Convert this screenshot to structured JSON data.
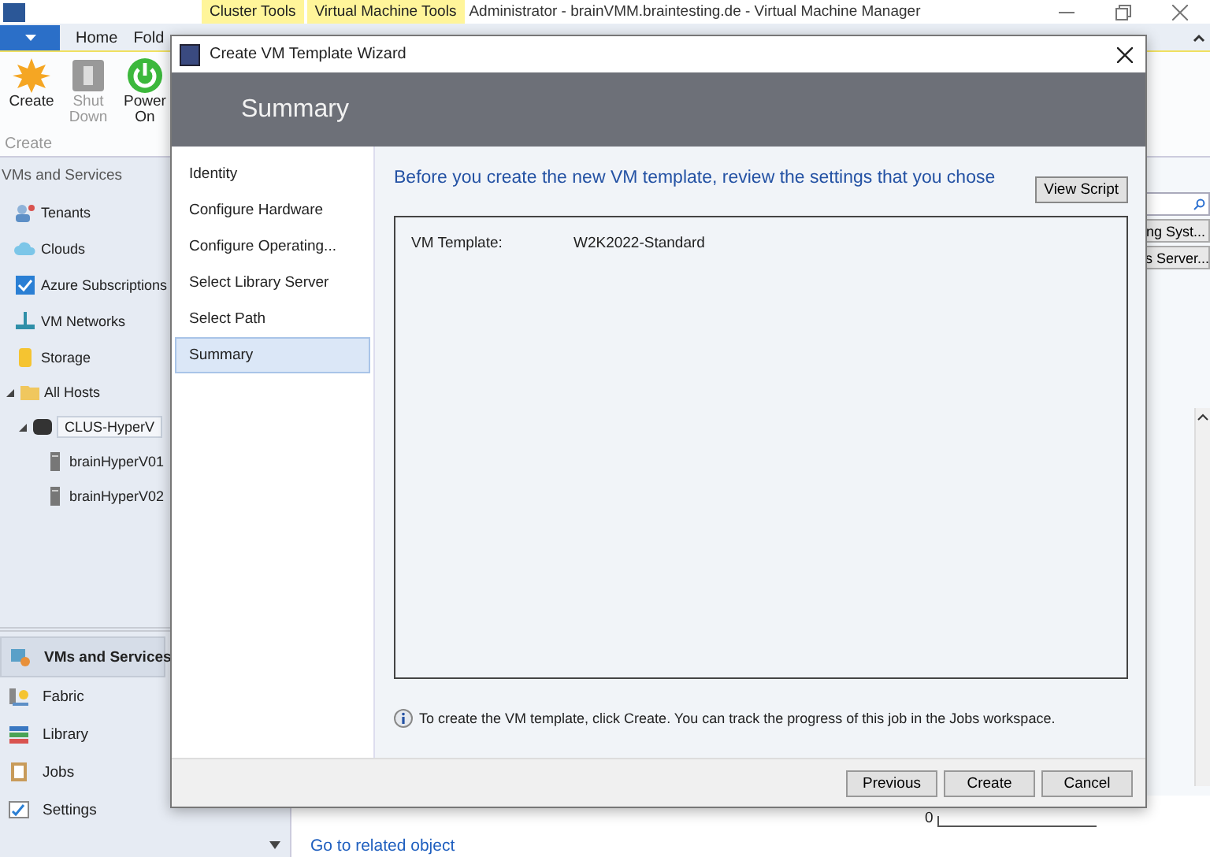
{
  "app": {
    "title": "Administrator - brainVMM.braintesting.de - Virtual Machine Manager",
    "contextual_tabs": [
      "Cluster Tools",
      "Virtual Machine Tools"
    ]
  },
  "ribbon": {
    "tabs": [
      "Home",
      "Fold"
    ],
    "buttons": [
      {
        "label": "Create",
        "kind": "create",
        "disabled": false
      },
      {
        "label": "Shut Down",
        "kind": "shutdown",
        "disabled": true
      },
      {
        "label": "Power On",
        "kind": "power",
        "disabled": false
      }
    ],
    "group_label": "Create"
  },
  "navigation": {
    "section": "VMs and Services",
    "items": [
      {
        "label": "Tenants",
        "kind": "tenants"
      },
      {
        "label": "Clouds",
        "kind": "clouds"
      },
      {
        "label": "Azure Subscriptions",
        "kind": "azure"
      },
      {
        "label": "VM Networks",
        "kind": "networks"
      },
      {
        "label": "Storage",
        "kind": "storage"
      }
    ],
    "tree": [
      {
        "label": "All Hosts",
        "kind": "folder",
        "expanded": true,
        "selected": false,
        "children": [
          {
            "label": "CLUS-HyperV",
            "kind": "cluster",
            "expanded": true,
            "selected": true,
            "children": [
              {
                "label": "brainHyperV01",
                "kind": "host"
              },
              {
                "label": "brainHyperV02",
                "kind": "host"
              }
            ]
          }
        ]
      }
    ]
  },
  "workspaces": [
    {
      "label": "VMs and Services",
      "kind": "vms",
      "selected": true
    },
    {
      "label": "Fabric",
      "kind": "fabric",
      "selected": false
    },
    {
      "label": "Library",
      "kind": "library",
      "selected": false
    },
    {
      "label": "Jobs",
      "kind": "jobs",
      "selected": false
    },
    {
      "label": "Settings",
      "kind": "settings",
      "selected": false
    }
  ],
  "background": {
    "panel_buttons": [
      "ng Syst...",
      "s Server..."
    ],
    "axis_label": "0",
    "link": "Go to related object"
  },
  "dialog": {
    "title": "Create VM Template Wizard",
    "header": "Summary",
    "steps": [
      {
        "label": "Identity",
        "selected": false
      },
      {
        "label": "Configure Hardware",
        "selected": false
      },
      {
        "label": "Configure Operating...",
        "selected": false
      },
      {
        "label": "Select Library Server",
        "selected": false
      },
      {
        "label": "Select Path",
        "selected": false
      },
      {
        "label": "Summary",
        "selected": true
      }
    ],
    "heading": "Before you create the new VM template, review the settings that you chose",
    "view_script": "View Script",
    "summary_rows": [
      {
        "label": "VM Template:",
        "value": "W2K2022-Standard"
      }
    ],
    "info": "To create the VM template, click Create. You can track the progress of this job in the Jobs workspace.",
    "buttons": [
      "Previous",
      "Create",
      "Cancel"
    ]
  }
}
